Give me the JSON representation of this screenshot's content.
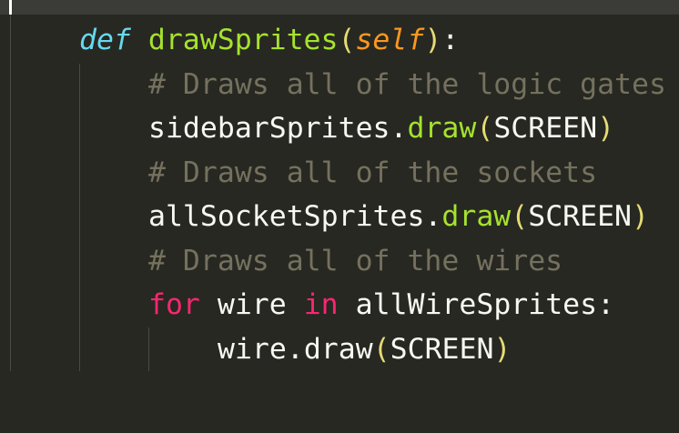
{
  "code": {
    "line1": {
      "kw": "def",
      "space": " ",
      "name": "drawSprites",
      "open": "(",
      "param": "self",
      "close": ")",
      "colon": ":"
    },
    "line2": {
      "comment": "# Draws all of the logic gates"
    },
    "line3": {
      "obj": "sidebarSprites.",
      "method": "draw",
      "open": "(",
      "arg": "SCREEN",
      "close": ")"
    },
    "line4": {
      "comment": "# Draws all of the sockets"
    },
    "line5": {
      "obj": "allSocketSprites.",
      "method": "draw",
      "open": "(",
      "arg": "SCREEN",
      "close": ")"
    },
    "line6": {
      "comment": "# Draws all of the wires"
    },
    "line7": {
      "kw_for": "for",
      "var": " wire ",
      "kw_in": "in",
      "iter": " allWireSprites:"
    },
    "line8": {
      "obj": "wire.draw",
      "open": "(",
      "arg": "SCREEN",
      "close": ")"
    }
  },
  "colors": {
    "background": "#272822",
    "keyword": "#f92672",
    "storage": "#66d9ef",
    "function": "#a6e22e",
    "parameter": "#fd971f",
    "comment": "#75715e",
    "bracket": "#e6db74",
    "text": "#f8f8f2"
  }
}
